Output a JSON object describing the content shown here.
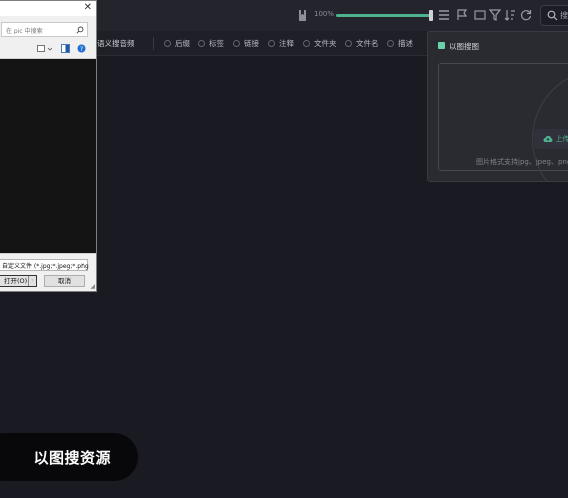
{
  "topbar": {
    "zoom_label": "100%",
    "zoom_level_fraction": 1.0,
    "search_label": "搜",
    "icons": [
      "book-icon",
      "list-icon",
      "flag-icon",
      "rectangle-icon",
      "filter-icon",
      "sort-icon",
      "refresh-icon",
      "search-icon"
    ],
    "accent_color": "#4eb28f"
  },
  "filterbar": {
    "semantic_label": "语义搜音频",
    "options": [
      "后缀",
      "标签",
      "链接",
      "注释",
      "文件夹",
      "文件名",
      "描述"
    ]
  },
  "image_search": {
    "title": "以图搜图",
    "upload_label": "上传",
    "formats_text": "图片格式支持jpg、jpeg、png、j"
  },
  "file_dialog": {
    "search_placeholder": "在 pic 中搜索",
    "file_type": "自定义文件 (*.jpg;*.jpeg;*.png",
    "open_label": "打开(O)",
    "cancel_label": "取消"
  },
  "caption": {
    "text": "以图搜资源"
  }
}
